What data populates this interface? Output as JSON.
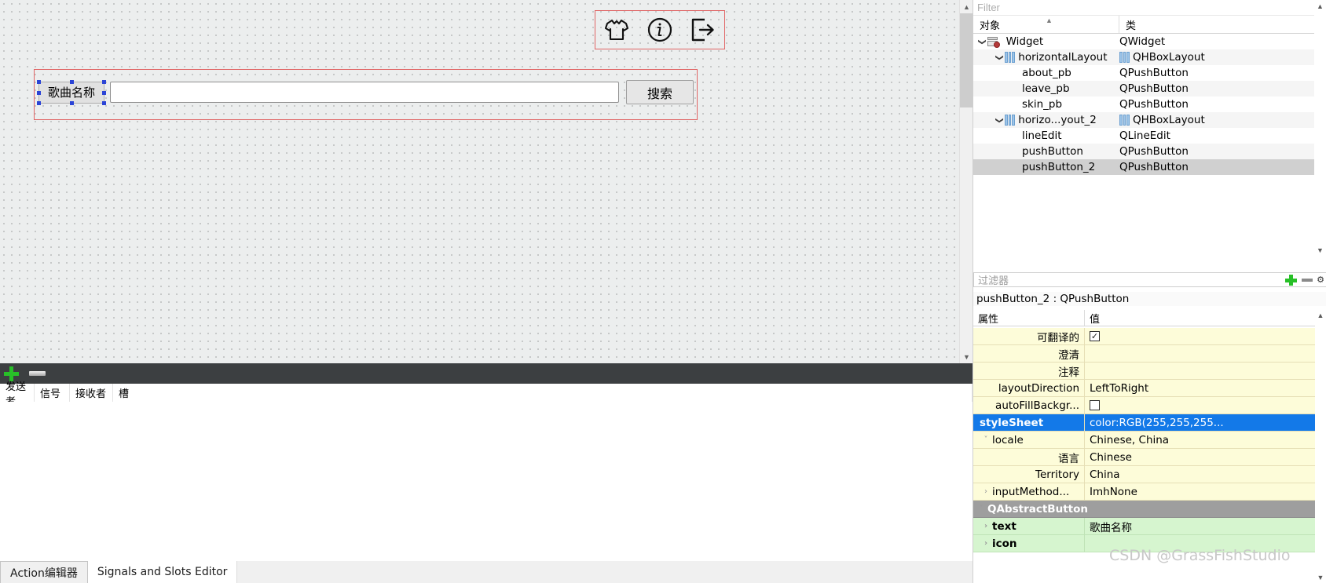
{
  "canvas": {
    "top_buttons": [
      {
        "name": "skin_pb",
        "icon": "tshirt-icon"
      },
      {
        "name": "about_pb",
        "icon": "info-circle-icon"
      },
      {
        "name": "leave_pb",
        "icon": "exit-door-icon"
      }
    ],
    "search_row": {
      "label_button_text": "歌曲名称",
      "lineedit_value": "",
      "search_button_text": "搜索"
    }
  },
  "signals_slots": {
    "toolbar": {
      "add": "add-icon",
      "remove": "remove-icon"
    },
    "columns": [
      "发送者",
      "信号",
      "接收者",
      "槽"
    ],
    "rows": []
  },
  "bottom_tabs": [
    {
      "label": "Action编辑器",
      "selected": true
    },
    {
      "label": "Signals and Slots Editor",
      "selected": false
    }
  ],
  "object_inspector": {
    "filter_placeholder": "Filter",
    "columns": [
      "对象",
      "类"
    ],
    "rows": [
      {
        "indent": 0,
        "expander": "v",
        "icon": "widget-icon",
        "name": "Widget",
        "class": "QWidget",
        "class_icon": "",
        "selected": false,
        "alt": false
      },
      {
        "indent": 1,
        "expander": "v",
        "icon": "layout-icon",
        "name": "horizontalLayout",
        "class": "QHBoxLayout",
        "class_icon": "layout-icon",
        "selected": false,
        "alt": true
      },
      {
        "indent": 2,
        "expander": "",
        "icon": "",
        "name": "about_pb",
        "class": "QPushButton",
        "class_icon": "",
        "selected": false,
        "alt": false
      },
      {
        "indent": 2,
        "expander": "",
        "icon": "",
        "name": "leave_pb",
        "class": "QPushButton",
        "class_icon": "",
        "selected": false,
        "alt": true
      },
      {
        "indent": 2,
        "expander": "",
        "icon": "",
        "name": "skin_pb",
        "class": "QPushButton",
        "class_icon": "",
        "selected": false,
        "alt": false
      },
      {
        "indent": 1,
        "expander": "v",
        "icon": "layout-icon",
        "name": "horizo...yout_2",
        "class": "QHBoxLayout",
        "class_icon": "layout-icon",
        "selected": false,
        "alt": true
      },
      {
        "indent": 2,
        "expander": "",
        "icon": "",
        "name": "lineEdit",
        "class": "QLineEdit",
        "class_icon": "",
        "selected": false,
        "alt": false
      },
      {
        "indent": 2,
        "expander": "",
        "icon": "",
        "name": "pushButton",
        "class": "QPushButton",
        "class_icon": "",
        "selected": false,
        "alt": true
      },
      {
        "indent": 2,
        "expander": "",
        "icon": "",
        "name": "pushButton_2",
        "class": "QPushButton",
        "class_icon": "",
        "selected": true,
        "alt": false
      }
    ]
  },
  "property_editor": {
    "filter_placeholder": "过滤器",
    "object_title": "pushButton_2 : QPushButton",
    "columns": [
      "属性",
      "值"
    ],
    "rows": [
      {
        "style": "indent",
        "expander": "",
        "name": "可翻译的",
        "value": "",
        "checkbox": true,
        "checked": true
      },
      {
        "style": "indent",
        "expander": "",
        "name": "澄清",
        "value": ""
      },
      {
        "style": "indent",
        "expander": "",
        "name": "注释",
        "value": ""
      },
      {
        "style": "right",
        "expander": "",
        "name": "layoutDirection",
        "value": "LeftToRight"
      },
      {
        "style": "right",
        "expander": "",
        "name": "autoFillBackgr...",
        "value": "",
        "checkbox": true,
        "checked": false
      },
      {
        "style": "selected",
        "expander": "",
        "name": "styleSheet",
        "value": "color:RGB(255,255,255..."
      },
      {
        "style": "left",
        "expander": "v",
        "name": "locale",
        "value": "Chinese, China"
      },
      {
        "style": "indent",
        "expander": "",
        "name": "语言",
        "value": "Chinese"
      },
      {
        "style": "indent",
        "expander": "",
        "name": "Territory",
        "value": "China"
      },
      {
        "style": "left",
        "expander": ">",
        "name": "inputMethod...",
        "value": "ImhNone"
      },
      {
        "style": "group",
        "expander": "v",
        "name": "QAbstractButton",
        "value": ""
      },
      {
        "style": "green",
        "expander": ">",
        "name": "text",
        "value": "歌曲名称"
      },
      {
        "style": "green",
        "expander": ">",
        "name": "icon",
        "value": ""
      }
    ]
  },
  "watermark": "CSDN @GrassFishStudio"
}
